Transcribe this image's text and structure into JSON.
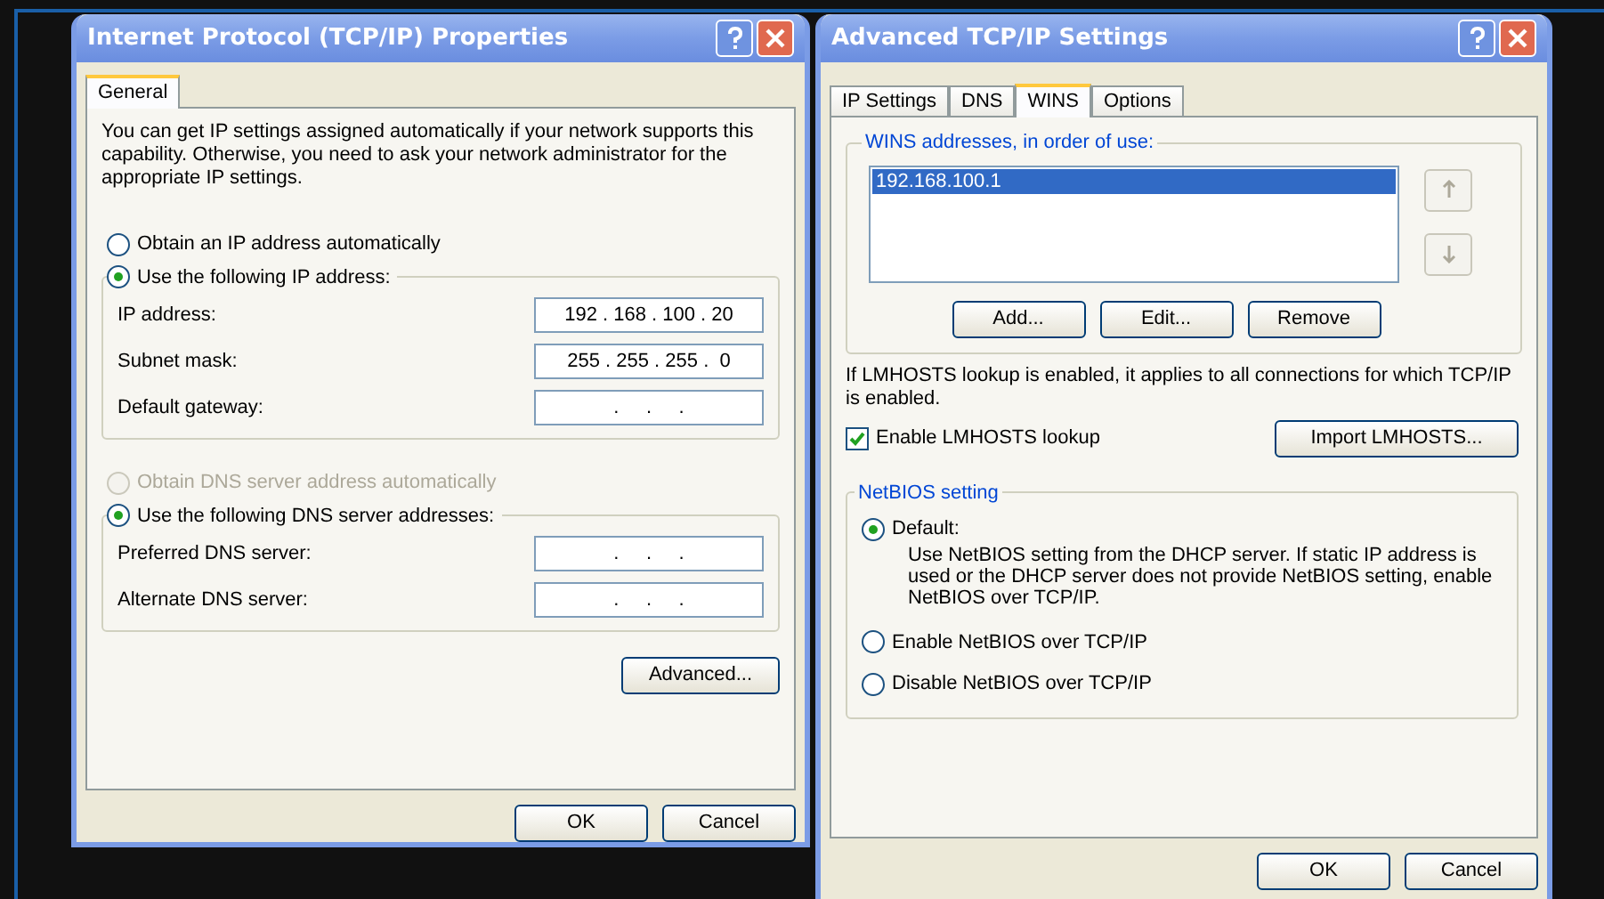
{
  "ip_properties": {
    "title": "Internet Protocol (TCP/IP) Properties",
    "tabs": [
      {
        "label": "General",
        "selected": true
      }
    ],
    "intro": "You can get IP settings assigned automatically if your network supports this capability. Otherwise, you need to ask your network administrator for the appropriate IP settings.",
    "ip_options": [
      {
        "label": "Obtain an IP address automatically",
        "selected": false,
        "disabled": false
      },
      {
        "label": "Use the following IP address:",
        "selected": true,
        "disabled": false
      }
    ],
    "ip_fields": [
      {
        "label": "IP address:",
        "value": "192 . 168 . 100 . 20"
      },
      {
        "label": "Subnet mask:",
        "value": "255 . 255 . 255 .  0"
      },
      {
        "label": "Default gateway:",
        "value": ".     .     ."
      }
    ],
    "dns_options": [
      {
        "label": "Obtain DNS server address automatically",
        "selected": false,
        "disabled": true
      },
      {
        "label": "Use the following DNS server addresses:",
        "selected": true,
        "disabled": false
      }
    ],
    "dns_fields": [
      {
        "label": "Preferred DNS server:",
        "value": ".     .     ."
      },
      {
        "label": "Alternate DNS server:",
        "value": ".     .     ."
      }
    ],
    "advanced_button": "Advanced...",
    "buttons": [
      "OK",
      "Cancel"
    ]
  },
  "advanced_settings": {
    "title": "Advanced TCP/IP Settings",
    "tabs": [
      {
        "label": "IP Settings",
        "selected": false
      },
      {
        "label": "DNS",
        "selected": false
      },
      {
        "label": "WINS",
        "selected": true
      },
      {
        "label": "Options",
        "selected": false
      }
    ],
    "wins_group": "WINS addresses, in order of use:",
    "wins_addresses": [
      {
        "text": "192.168.100.1",
        "selected": true
      }
    ],
    "list_buttons": [
      "Add...",
      "Edit...",
      "Remove"
    ],
    "note": "If LMHOSTS lookup is enabled, it applies to all connections for which TCP/IP is enabled.",
    "lmhosts": {
      "label": "Enable LMHOSTS lookup",
      "checked": true
    },
    "import_button": "Import LMHOSTS...",
    "netbios_group": "NetBIOS setting",
    "netbios_options": [
      {
        "label": "Default:",
        "selected": true,
        "disabled": false,
        "description": "Use NetBIOS setting from the DHCP server. If static IP address is used or the DHCP server does not provide NetBIOS setting, enable NetBIOS over TCP/IP."
      },
      {
        "label": "Enable NetBIOS over TCP/IP",
        "selected": false,
        "disabled": false
      },
      {
        "label": "Disable NetBIOS over TCP/IP",
        "selected": false,
        "disabled": false
      }
    ],
    "buttons": [
      "OK",
      "Cancel"
    ]
  }
}
